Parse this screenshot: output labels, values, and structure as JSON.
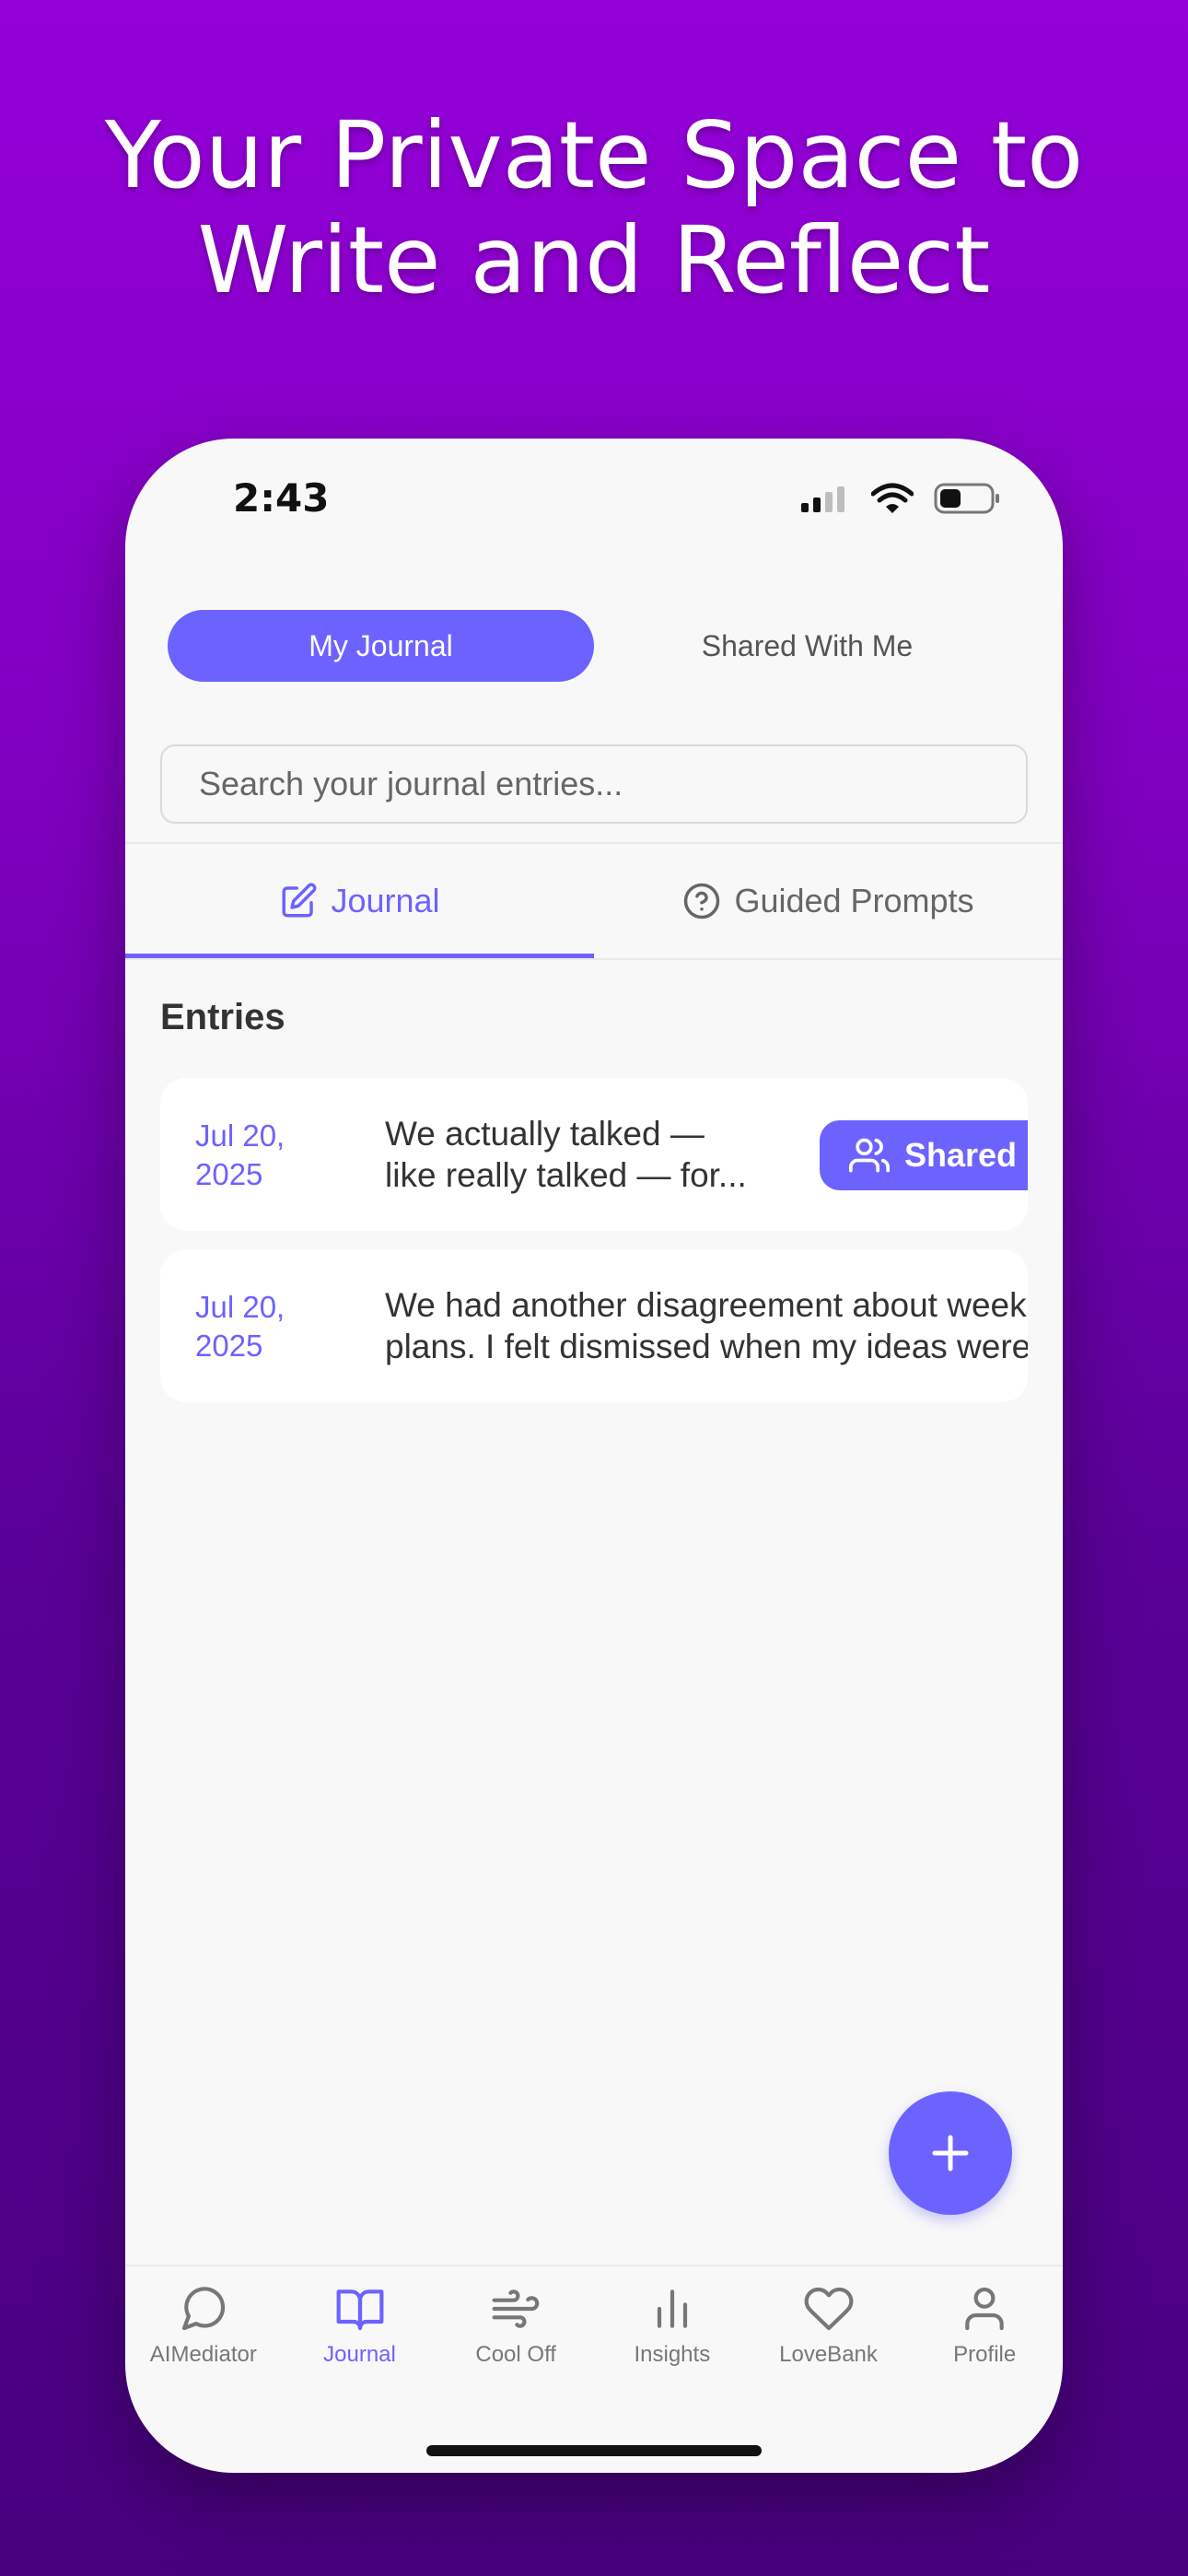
{
  "headline": {
    "line1": "Your Private Space to",
    "line2": "Write and Reflect"
  },
  "status_bar": {
    "time": "2:43"
  },
  "segmented": {
    "my_journal": "My Journal",
    "shared_with_me": "Shared With Me"
  },
  "search": {
    "placeholder": "Search your journal entries..."
  },
  "tabs": {
    "journal": "Journal",
    "guided_prompts": "Guided Prompts"
  },
  "entries": {
    "title": "Entries",
    "items": [
      {
        "date_line1": "Jul 20,",
        "date_line2": "2025",
        "text_line1": "We actually talked —",
        "text_line2": "like really talked — for...",
        "badge": "Shared"
      },
      {
        "date_line1": "Jul 20,",
        "date_line2": "2025",
        "text_line1": "We had another disagreement about weekend",
        "text_line2": "plans. I felt dismissed when my ideas were"
      }
    ]
  },
  "bottom_nav": {
    "items": [
      {
        "label": "AIMediator",
        "icon": "chat-bubble-icon"
      },
      {
        "label": "Journal",
        "icon": "open-book-icon"
      },
      {
        "label": "Cool Off",
        "icon": "wind-icon"
      },
      {
        "label": "Insights",
        "icon": "bar-chart-icon"
      },
      {
        "label": "LoveBank",
        "icon": "heart-icon"
      },
      {
        "label": "Profile",
        "icon": "person-icon"
      }
    ]
  },
  "colors": {
    "accent": "#6C63FF",
    "background_top": "#9400D8",
    "background_bottom": "#48007E"
  }
}
